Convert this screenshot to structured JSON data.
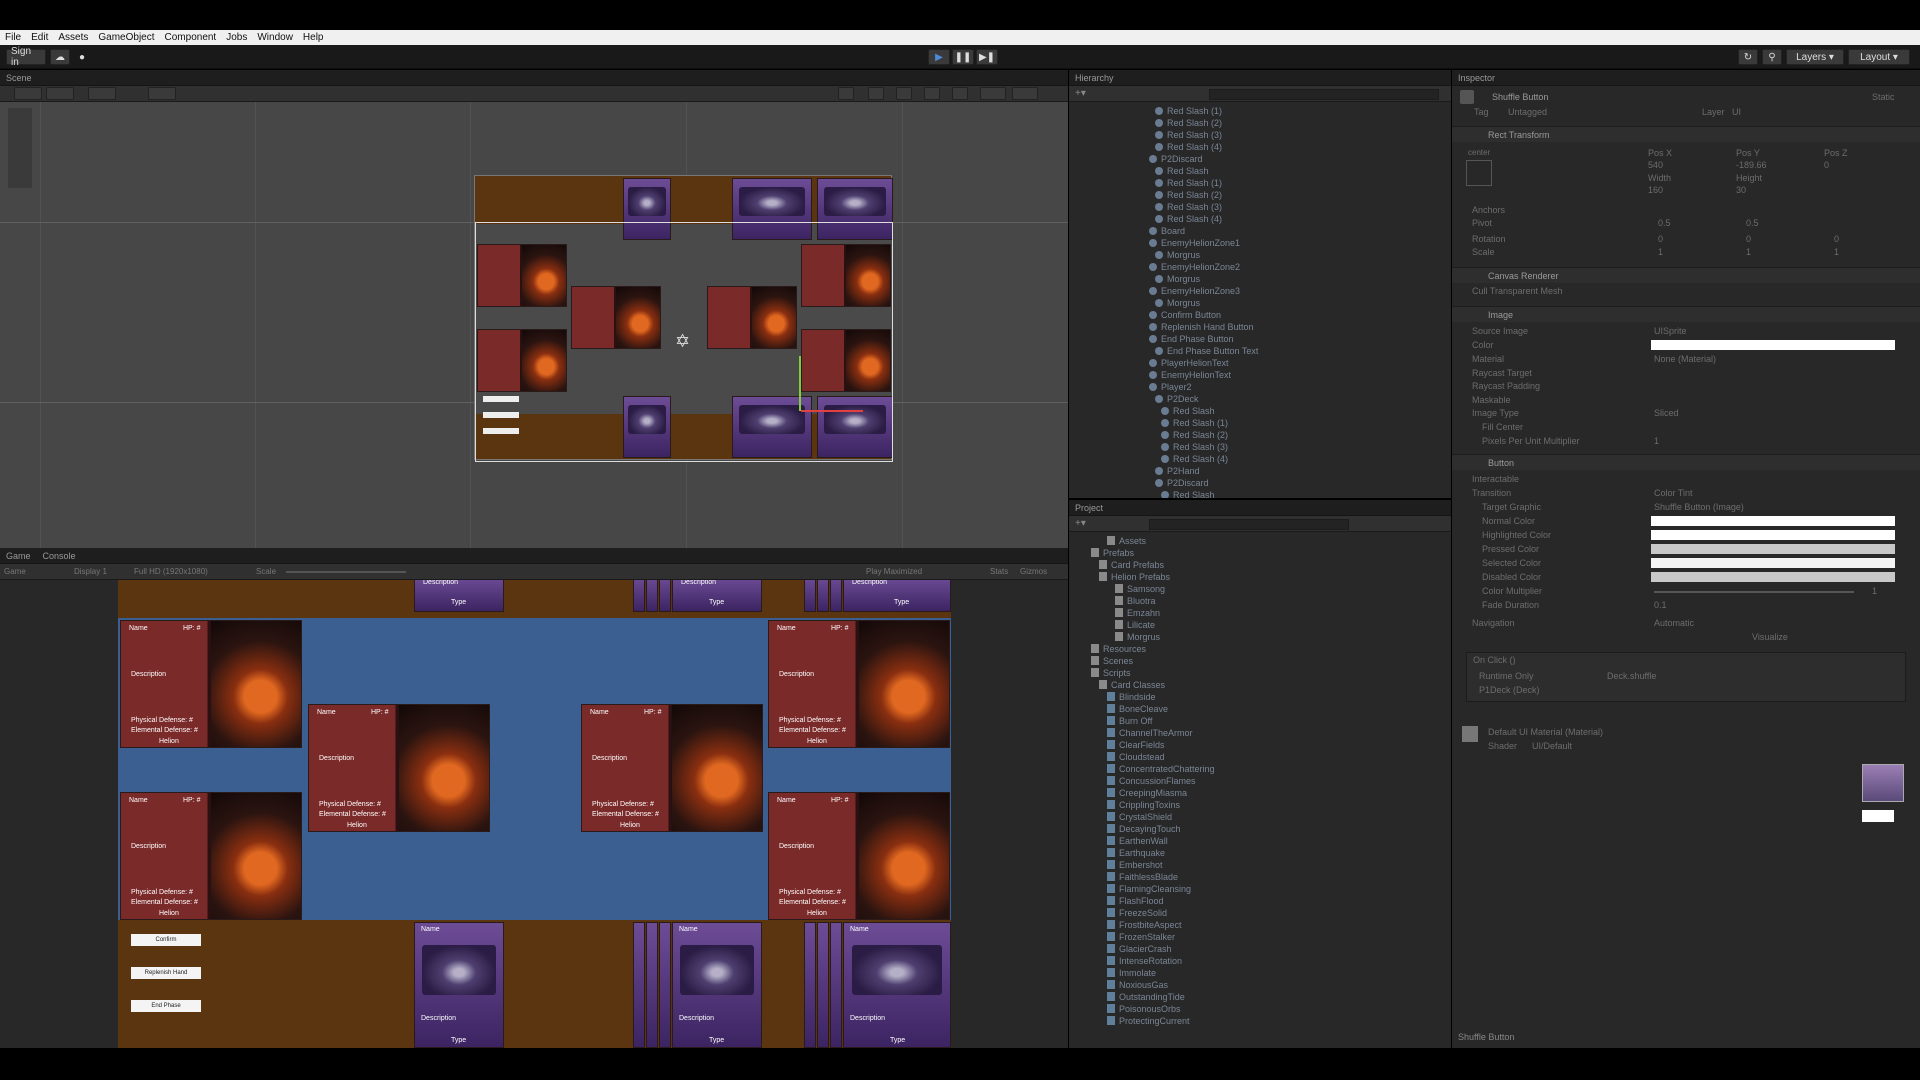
{
  "menu": [
    "File",
    "Edit",
    "Assets",
    "GameObject",
    "Component",
    "Jobs",
    "Window",
    "Help"
  ],
  "toolbar": {
    "sign_in": "Sign in",
    "layers": "Layers",
    "layout": "Layout"
  },
  "tabs": {
    "scene": "Scene",
    "game": "Game",
    "console": "Console",
    "hierarchy": "Hierarchy",
    "project": "Project",
    "inspector": "Inspector"
  },
  "game_bar": {
    "view": "Game",
    "display": "Display 1",
    "resolution": "Full HD (1920x1080)",
    "scale": "Scale",
    "play": "Play Maximized",
    "stats": "Stats",
    "gizmos": "Gizmos"
  },
  "card": {
    "name": "Name",
    "hp": "HP: #",
    "description": "Description",
    "physical": "Physical Defense: #",
    "elemental": "Elemental Defense: #",
    "faction": "Helion",
    "type": "Type"
  },
  "game_buttons": [
    "Confirm",
    "Replenish Hand",
    "End Phase"
  ],
  "hierarchy_items": [
    "Red Slash (1)",
    "Red Slash (2)",
    "Red Slash (3)",
    "Red Slash (4)",
    "P2Discard",
    "Red Slash",
    "Red Slash (1)",
    "Red Slash (2)",
    "Red Slash (3)",
    "Red Slash (4)",
    "Board",
    "EnemyHelionZone1",
    "Morgrus",
    "EnemyHelionZone2",
    "Morgrus",
    "EnemyHelionZone3",
    "Morgrus",
    "Confirm Button",
    "Replenish Hand Button",
    "End Phase Button",
    "End Phase Button Text",
    "PlayerHelionText",
    "EnemyHelionText",
    "Player2",
    "P2Deck",
    "Red Slash",
    "Red Slash (1)",
    "Red Slash (2)",
    "Red Slash (3)",
    "Red Slash (4)",
    "P2Hand",
    "P2Discard",
    "Red Slash"
  ],
  "project_items": [
    "Assets",
    "Prefabs",
    "Card Prefabs",
    "Helion Prefabs",
    "Samsong",
    "Bluotra",
    "Emzahn",
    "Lilicate",
    "Morgrus",
    "Resources",
    "Scenes",
    "Scripts",
    "Card Classes",
    "Blindside",
    "BoneCleave",
    "Burn Off",
    "ChannelTheArmor",
    "ClearFields",
    "Cloudstead",
    "ConcentratedChattering",
    "ConcussionFlames",
    "CreepingMiasma",
    "CripplingToxins",
    "CrystalShield",
    "DecayingTouch",
    "EarthenWall",
    "Earthquake",
    "Embershot",
    "FaithlessBlade",
    "FlamingCleansing",
    "FlashFlood",
    "FreezeSolid",
    "FrostbiteAspect",
    "FrozenStalker",
    "GlacierCrash",
    "IntenseRotation",
    "Immolate",
    "NoxiousGas",
    "OutstandingTide",
    "PoisonousOrbs",
    "ProtectingCurrent"
  ],
  "inspector": {
    "object": "Shuffle Button",
    "static": "Static",
    "tag_label": "Tag",
    "tag": "Untagged",
    "layer_label": "Layer",
    "layer": "UI",
    "rect_transform": "Rect Transform",
    "center": "center",
    "pos_x_label": "Pos X",
    "pos_y_label": "Pos Y",
    "pos_z_label": "Pos Z",
    "pos_x": "540",
    "pos_y": "-189.66",
    "pos_z": "0",
    "width_label": "Width",
    "height_label": "Height",
    "width": "160",
    "height": "30",
    "anchors": "Anchors",
    "pivot": "Pivot",
    "pivot_x": "0.5",
    "pivot_y": "0.5",
    "rotation": "Rotation",
    "rot": [
      "0",
      "0",
      "0"
    ],
    "scale": "Scale",
    "scl": [
      "1",
      "1",
      "1"
    ],
    "canvas_renderer": "Canvas Renderer",
    "cull_mesh": "Cull Transparent Mesh",
    "image": "Image",
    "source_image": "Source Image",
    "source_value": "UISprite",
    "color": "Color",
    "material": "Material",
    "material_value": "None (Material)",
    "raycast_target": "Raycast Target",
    "raycast_padding": "Raycast Padding",
    "maskable": "Maskable",
    "image_type": "Image Type",
    "image_type_value": "Sliced",
    "fill_center": "Fill Center",
    "ppu_label": "Pixels Per Unit Multiplier",
    "ppu": "1",
    "button": "Button",
    "interactable": "Interactable",
    "transition": "Transition",
    "transition_value": "Color Tint",
    "target_graphic": "Target Graphic",
    "target_value": "Shuffle Button (Image)",
    "normal": "Normal Color",
    "highlighted": "Highlighted Color",
    "pressed": "Pressed Color",
    "selected": "Selected Color",
    "disabled": "Disabled Color",
    "multiplier": "Color Multiplier",
    "multiplier_value": "1",
    "fade": "Fade Duration",
    "fade_value": "0.1",
    "navigation": "Navigation",
    "navigation_value": "Automatic",
    "visualize": "Visualize",
    "onclick": "On Click ()",
    "runtime": "Runtime Only",
    "function": "Deck.shuffle",
    "target_obj": "P1Deck (Deck)",
    "material_section": "Default UI Material (Material)",
    "shader_label": "Shader",
    "shader": "UI/Default",
    "footer": "Shuffle Button"
  },
  "colors": {
    "accent": "#4c8cd6",
    "board": "#3c5f92",
    "table": "#5b3510"
  }
}
